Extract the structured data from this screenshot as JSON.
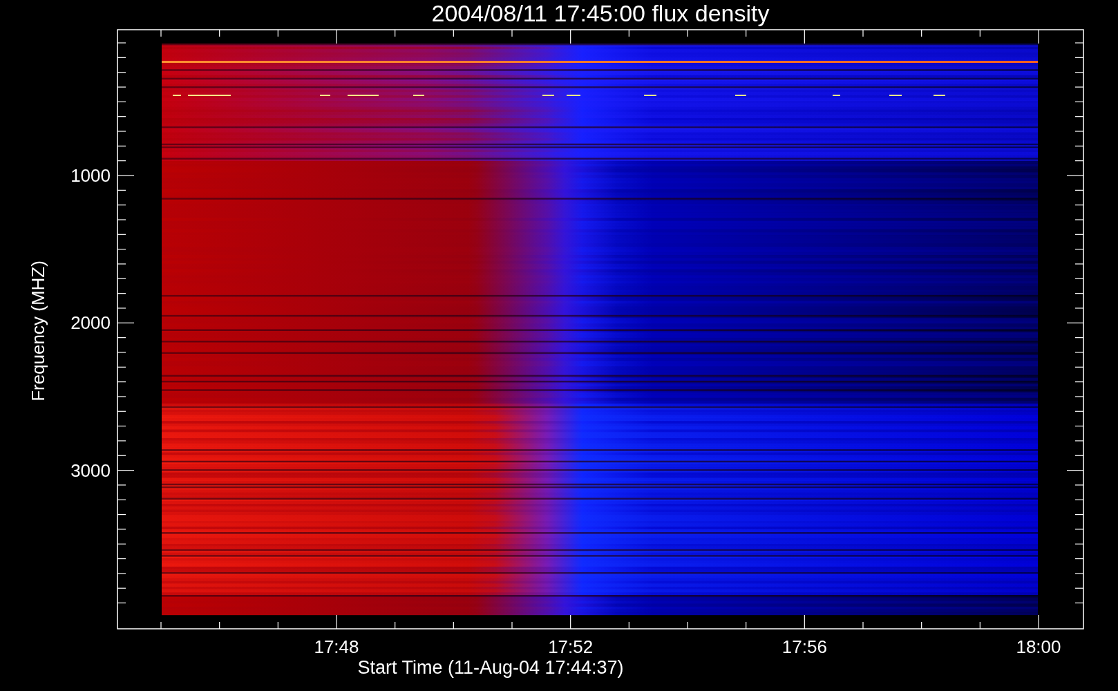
{
  "plot": {
    "title": "2004/08/11 17:45:00 flux density",
    "xlabel": "Start Time (11-Aug-04 17:44:37)",
    "ylabel": "Frequency (MHZ)",
    "x_tick_labels": [
      "17:48",
      "17:52",
      "17:56",
      "18:00"
    ],
    "y_tick_labels": [
      "1000",
      "2000",
      "3000"
    ]
  }
}
